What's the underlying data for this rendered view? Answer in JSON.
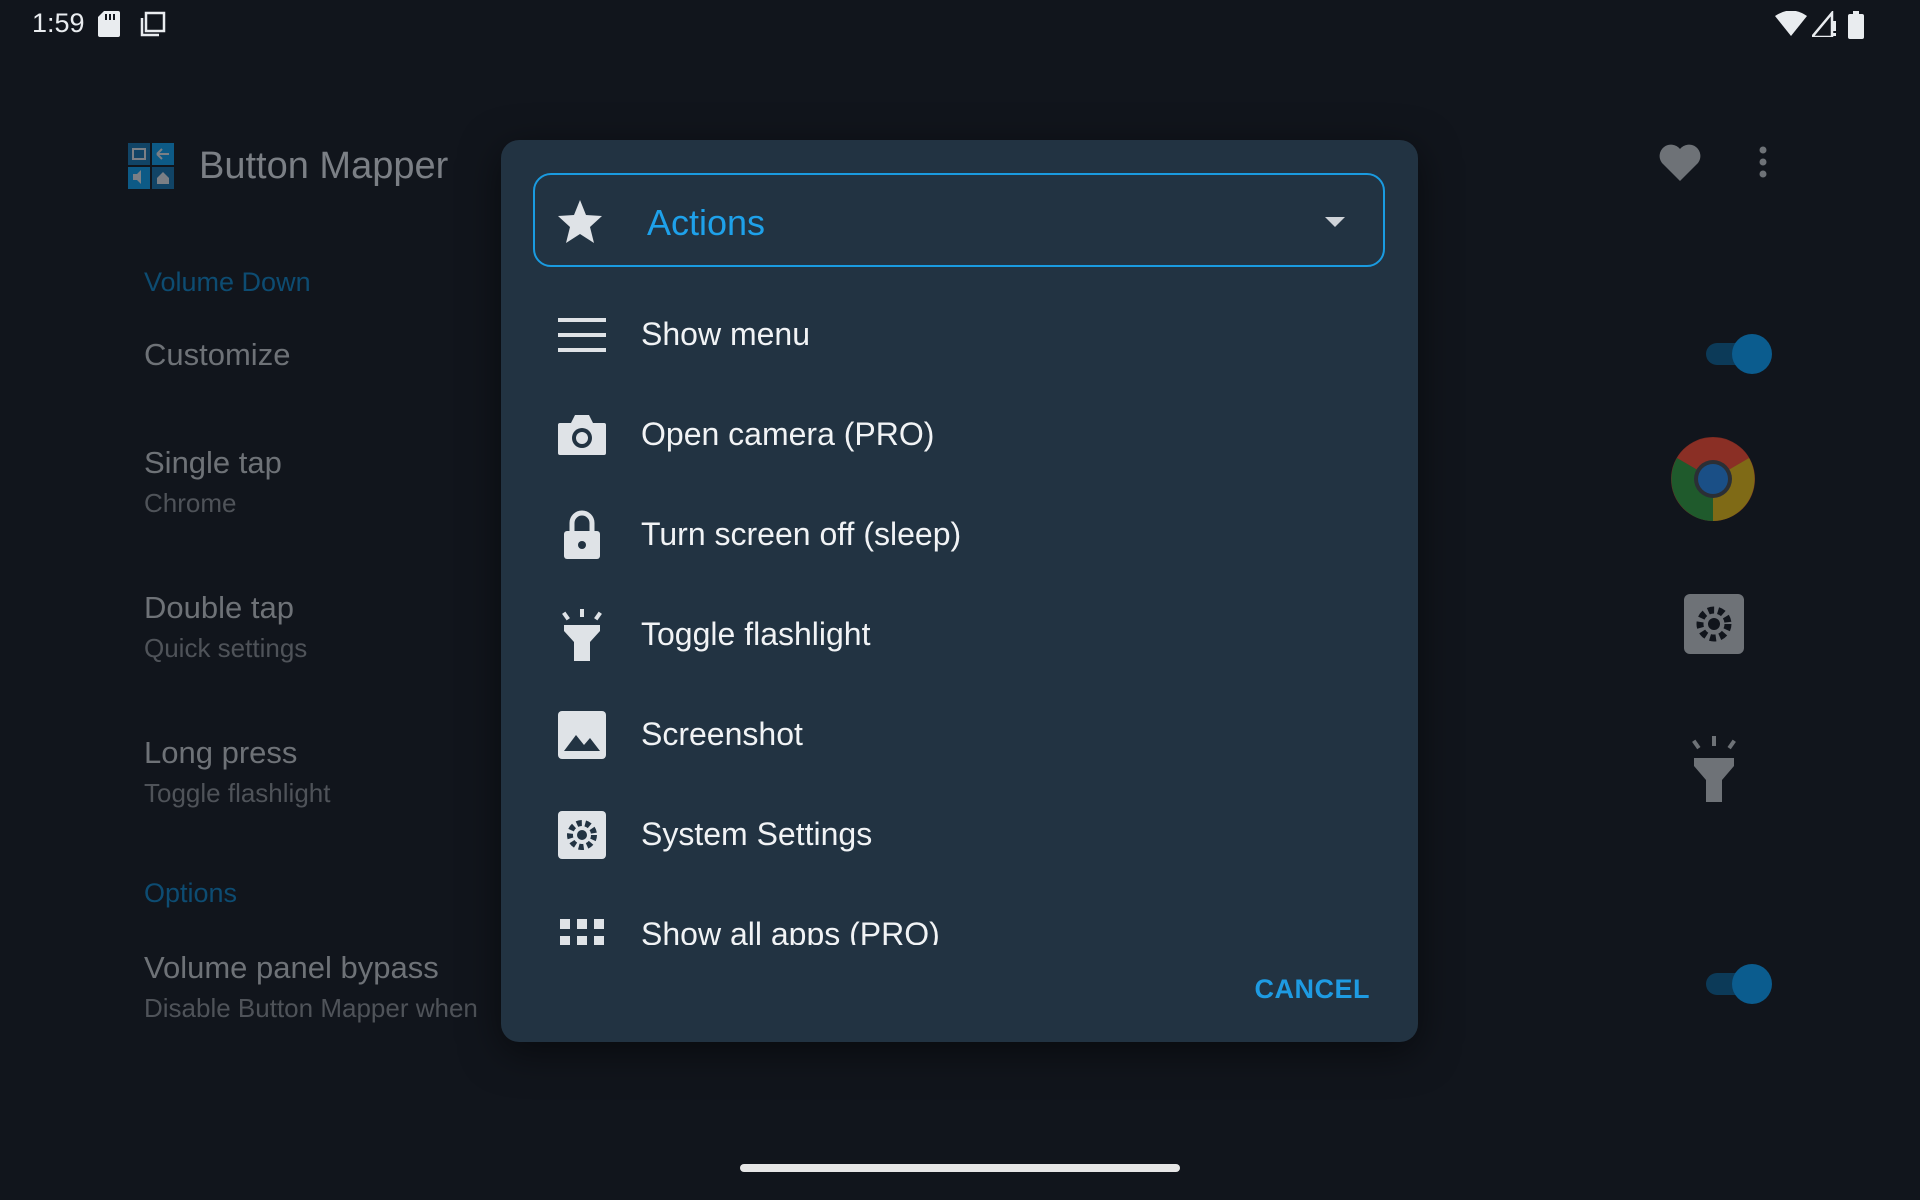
{
  "status_bar": {
    "time": "1:59",
    "icons": [
      "sd-card-icon",
      "screenshot-notification-icon",
      "wifi-icon",
      "signal-icon",
      "battery-icon"
    ]
  },
  "app": {
    "title": "Button Mapper",
    "sections": [
      {
        "label": "Volume Down"
      },
      {
        "label": "Options"
      }
    ],
    "prefs": {
      "customize": {
        "title": "Customize",
        "enabled": true
      },
      "single_tap": {
        "title": "Single tap",
        "subtitle": "Chrome"
      },
      "double_tap": {
        "title": "Double tap",
        "subtitle": "Quick settings"
      },
      "long_press": {
        "title": "Long press",
        "subtitle": "Toggle flashlight"
      },
      "volume_panel_bypass": {
        "title": "Volume panel bypass",
        "subtitle": "Disable Button Mapper when",
        "enabled": true
      }
    }
  },
  "dialog": {
    "category": {
      "selected": "Actions",
      "icon": "star-icon"
    },
    "items": [
      {
        "label": "Show menu",
        "icon": "menu-icon"
      },
      {
        "label": "Open camera (PRO)",
        "icon": "camera-icon"
      },
      {
        "label": "Turn screen off (sleep)",
        "icon": "lock-icon"
      },
      {
        "label": "Toggle flashlight",
        "icon": "flashlight-icon"
      },
      {
        "label": "Screenshot",
        "icon": "image-icon"
      },
      {
        "label": "System Settings",
        "icon": "settings-icon"
      },
      {
        "label": "Show all apps (PRO)",
        "icon": "apps-grid-icon"
      }
    ],
    "cancel_label": "CANCEL"
  },
  "colors": {
    "accent": "#1ea1ea",
    "dialog_bg": "#223342",
    "screen_bg": "#11151c"
  }
}
